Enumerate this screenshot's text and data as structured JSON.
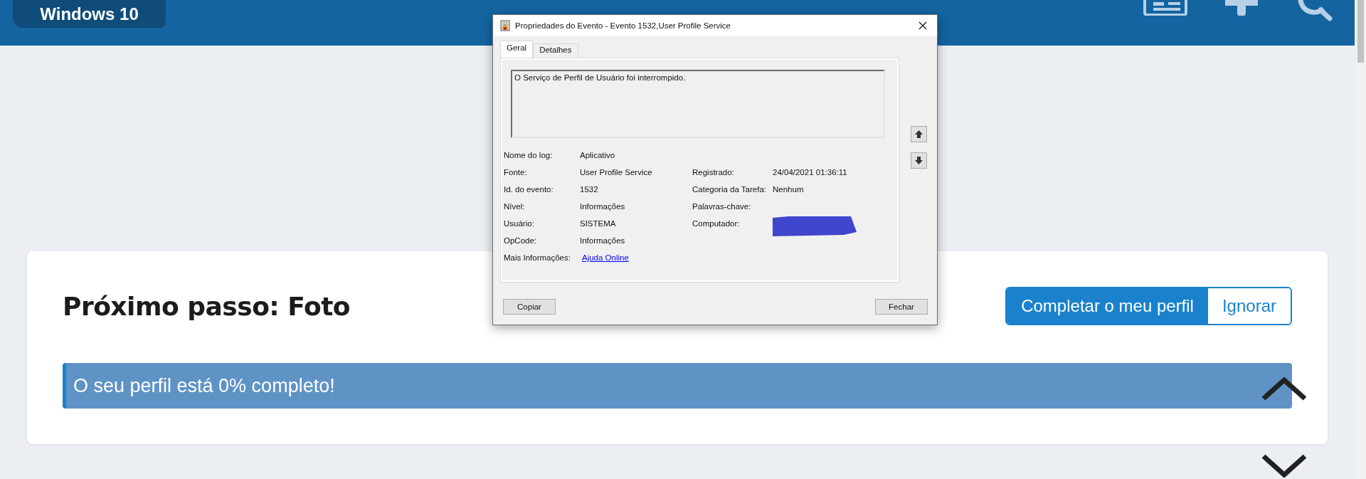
{
  "header": {
    "logo": "Windows 10"
  },
  "dialog": {
    "title": "Propriedades do Evento - Evento 1532,User Profile Service",
    "tabs": [
      {
        "label": "Geral",
        "selected": true
      },
      {
        "label": "Detalhes",
        "selected": false
      }
    ],
    "message": "O Serviço de Perfil de Usuário foi interrompido.",
    "rows": [
      {
        "left": {
          "label": "Nome do log:",
          "value": "Aplicativo"
        }
      },
      {
        "left": {
          "label": "Fonte:",
          "value": "User Profile Service"
        },
        "right": {
          "label": "Registrado:",
          "value": "24/04/2021 01:36:11"
        }
      },
      {
        "left": {
          "label": "Id. do evento:",
          "value": "1532"
        },
        "right": {
          "label": "Categoria da Tarefa:",
          "value": "Nenhum"
        }
      },
      {
        "left": {
          "label": "Nível:",
          "value": "Informações"
        },
        "right": {
          "label": "Palavras-chave:"
        }
      },
      {
        "left": {
          "label": "Usuário:",
          "value": "SISTEMA"
        },
        "right": {
          "label": "Computador:",
          "redacted": true
        }
      },
      {
        "left": {
          "label": "OpCode:",
          "value": "Informações"
        }
      },
      {
        "left": {
          "label": "Mais Informações:",
          "value": "Ajuda Online",
          "kind": "link"
        }
      }
    ],
    "buttons": [
      "Copiar",
      "Fechar"
    ]
  },
  "card": {
    "heading": "Próximo passo: Foto",
    "actions": [
      {
        "label": "Completar o meu perfil",
        "kind": "primary"
      },
      {
        "label": "Ignorar",
        "kind": "secondary"
      }
    ],
    "progress_text": "O seu perfil está 0% completo!"
  }
}
